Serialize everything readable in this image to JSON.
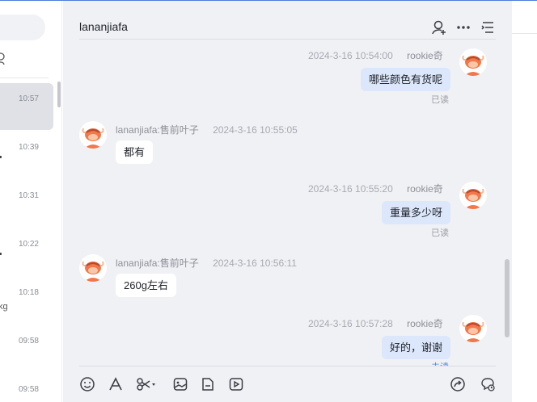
{
  "conversation_list": {
    "items": [
      {
        "time": "10:57",
        "active": true
      },
      {
        "time": "10:39",
        "active": false
      },
      {
        "time": "10:31",
        "active": false
      },
      {
        "time": "10:22",
        "active": false
      },
      {
        "time": "10:18",
        "active": false,
        "fragment": "kg"
      },
      {
        "time": "09:58",
        "active": false
      },
      {
        "time": "09:58",
        "active": false
      }
    ]
  },
  "chat": {
    "title": "lananjiafa",
    "messages": [
      {
        "direction": "out",
        "timestamp": "2024-3-16 10:54:00",
        "sender": "rookie奇",
        "text": "哪些颜色有货呢",
        "status": "已读"
      },
      {
        "direction": "in",
        "sender": "lananjiafa:售前叶子",
        "timestamp": "2024-3-16 10:55:05",
        "text": "都有"
      },
      {
        "direction": "out",
        "timestamp": "2024-3-16 10:55:20",
        "sender": "rookie奇",
        "text": "重量多少呀",
        "status": "已读"
      },
      {
        "direction": "in",
        "sender": "lananjiafa:售前叶子",
        "timestamp": "2024-3-16 10:56:11",
        "text": "260g左右"
      },
      {
        "direction": "out",
        "timestamp": "2024-3-16 10:57:28",
        "sender": "rookie奇",
        "text": "好的，谢谢",
        "status": "未读"
      }
    ]
  },
  "header_icons": [
    "add-contact-icon",
    "more-icon",
    "list-icon"
  ],
  "toolbar_icons": [
    "emoji-icon",
    "font-icon",
    "scissors-icon",
    "image-icon",
    "file-icon",
    "video-icon",
    "share-icon",
    "chat-record-icon"
  ],
  "colors": {
    "accent": "#4a86e8",
    "bubble_out": "#dce7fb",
    "avatar": "#f2784b"
  }
}
